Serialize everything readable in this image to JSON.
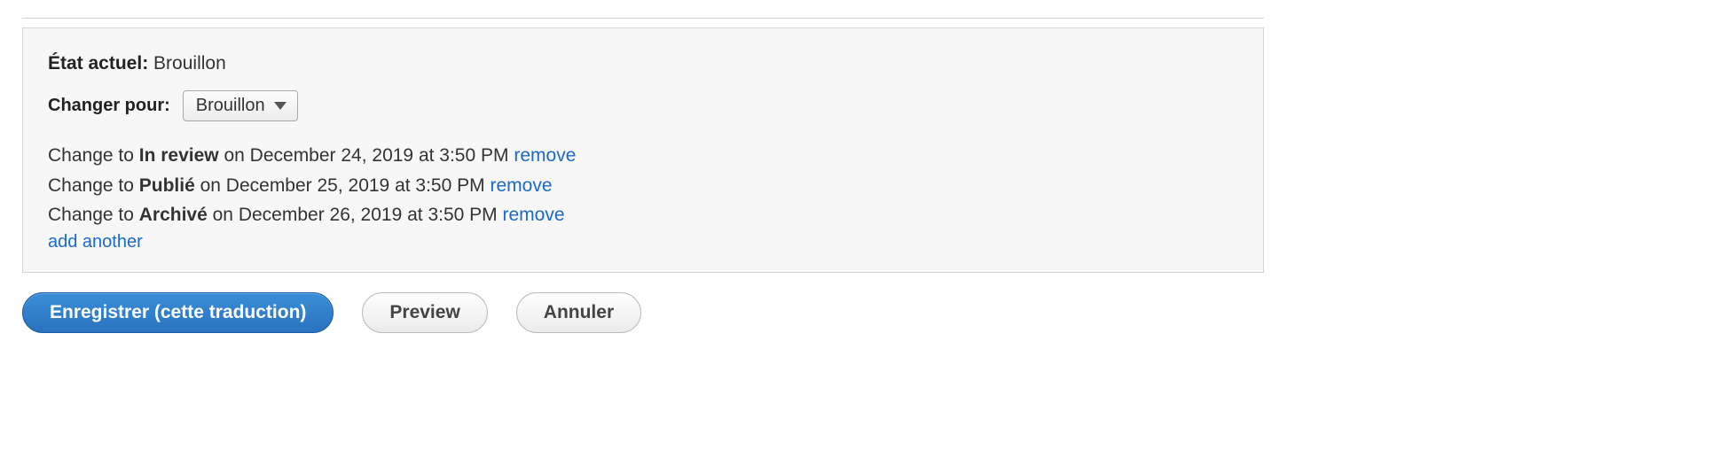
{
  "currentState": {
    "label": "État actuel:",
    "value": "Brouillon"
  },
  "changeTo": {
    "label": "Changer pour:",
    "selected": "Brouillon"
  },
  "transitions": [
    {
      "prefix": "Change to ",
      "state": "In review",
      "middle": " on December 24, 2019 at 3:50 PM ",
      "removeLabel": "remove"
    },
    {
      "prefix": "Change to ",
      "state": "Publié",
      "middle": " on December 25, 2019 at 3:50 PM ",
      "removeLabel": "remove"
    },
    {
      "prefix": "Change to ",
      "state": "Archivé",
      "middle": " on December 26, 2019 at 3:50 PM ",
      "removeLabel": "remove"
    }
  ],
  "addAnother": "add another",
  "buttons": {
    "save": "Enregistrer (cette traduction)",
    "preview": "Preview",
    "cancel": "Annuler"
  }
}
